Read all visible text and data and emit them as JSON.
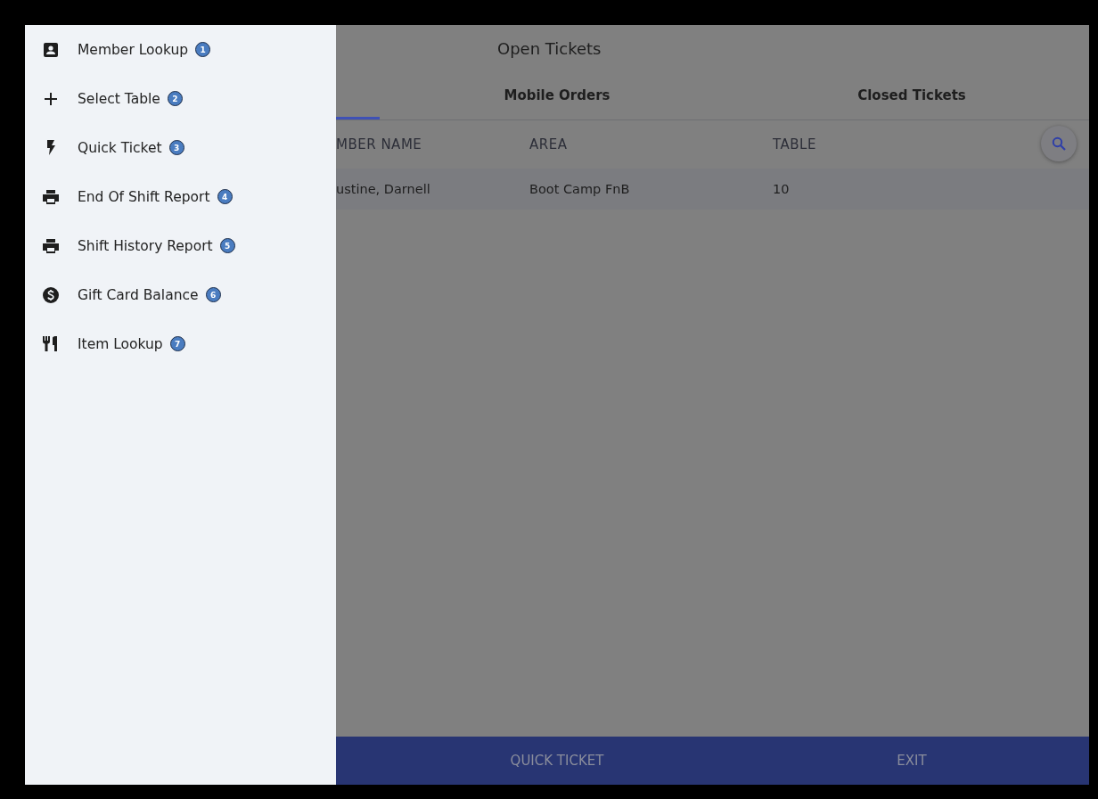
{
  "drawer": {
    "items": [
      {
        "label": "Member Lookup",
        "badge": "1"
      },
      {
        "label": "Select Table",
        "badge": "2"
      },
      {
        "label": "Quick Ticket",
        "badge": "3"
      },
      {
        "label": "End Of Shift Report",
        "badge": "4"
      },
      {
        "label": "Shift History Report",
        "badge": "5"
      },
      {
        "label": "Gift Card Balance",
        "badge": "6"
      },
      {
        "label": "Item Lookup",
        "badge": "7"
      }
    ]
  },
  "title": "Open Tickets",
  "tabs": [
    {
      "selected": true
    },
    {
      "label": "Mobile Orders",
      "selected": false
    },
    {
      "label": "Closed Tickets",
      "selected": false
    }
  ],
  "table": {
    "columns": [
      "MBER NAME",
      "AREA",
      "TABLE"
    ],
    "rows": [
      [
        "ustine, Darnell",
        "Boot Camp FnB",
        "10"
      ]
    ]
  },
  "bottom_bar": {
    "buttons": [
      "QUICK TICKET",
      "EXIT"
    ]
  }
}
